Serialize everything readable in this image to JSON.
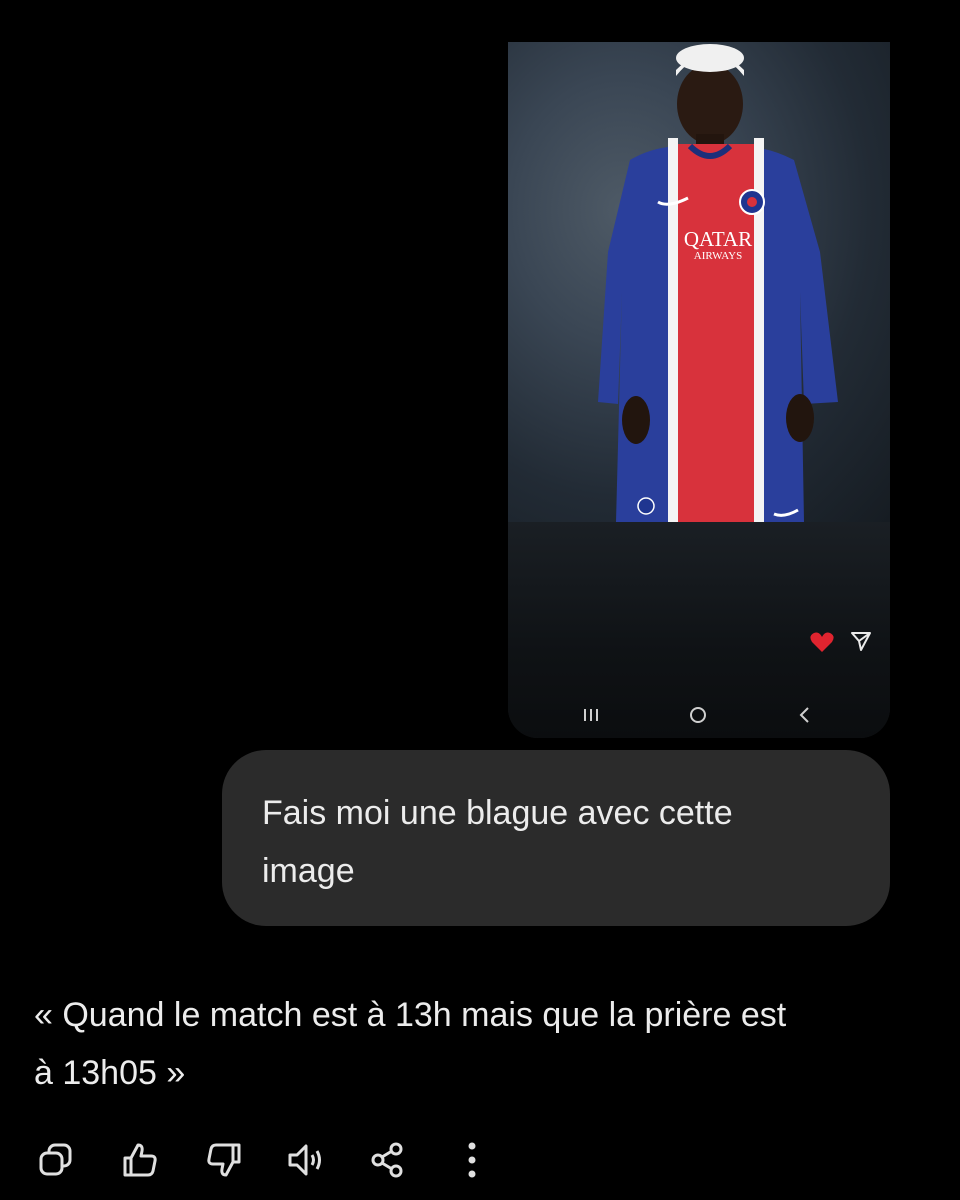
{
  "attachment": {
    "jersey_sponsor_line1": "QATAR",
    "jersey_sponsor_line2": "AIRWAYS",
    "icons": [
      "heart-icon",
      "send-icon",
      "recent-apps-icon",
      "home-icon",
      "back-icon"
    ],
    "heart_color": "#e0242f"
  },
  "user_message": {
    "line1": "Fais moi une blague avec cette",
    "line2": "image"
  },
  "assistant_reply": {
    "line1": "« Quand le match est à 13h mais que la prière est",
    "line2": "à 13h05 »"
  },
  "action_bar": {
    "icons": [
      "copy-icon",
      "thumbs-up-icon",
      "thumbs-down-icon",
      "speaker-icon",
      "share-icon",
      "more-icon"
    ]
  },
  "colors": {
    "background": "#000000",
    "bubble": "#2b2b2b",
    "text": "#ececec",
    "jersey_blue": "#2a3f9c",
    "jersey_red": "#d8323c"
  }
}
